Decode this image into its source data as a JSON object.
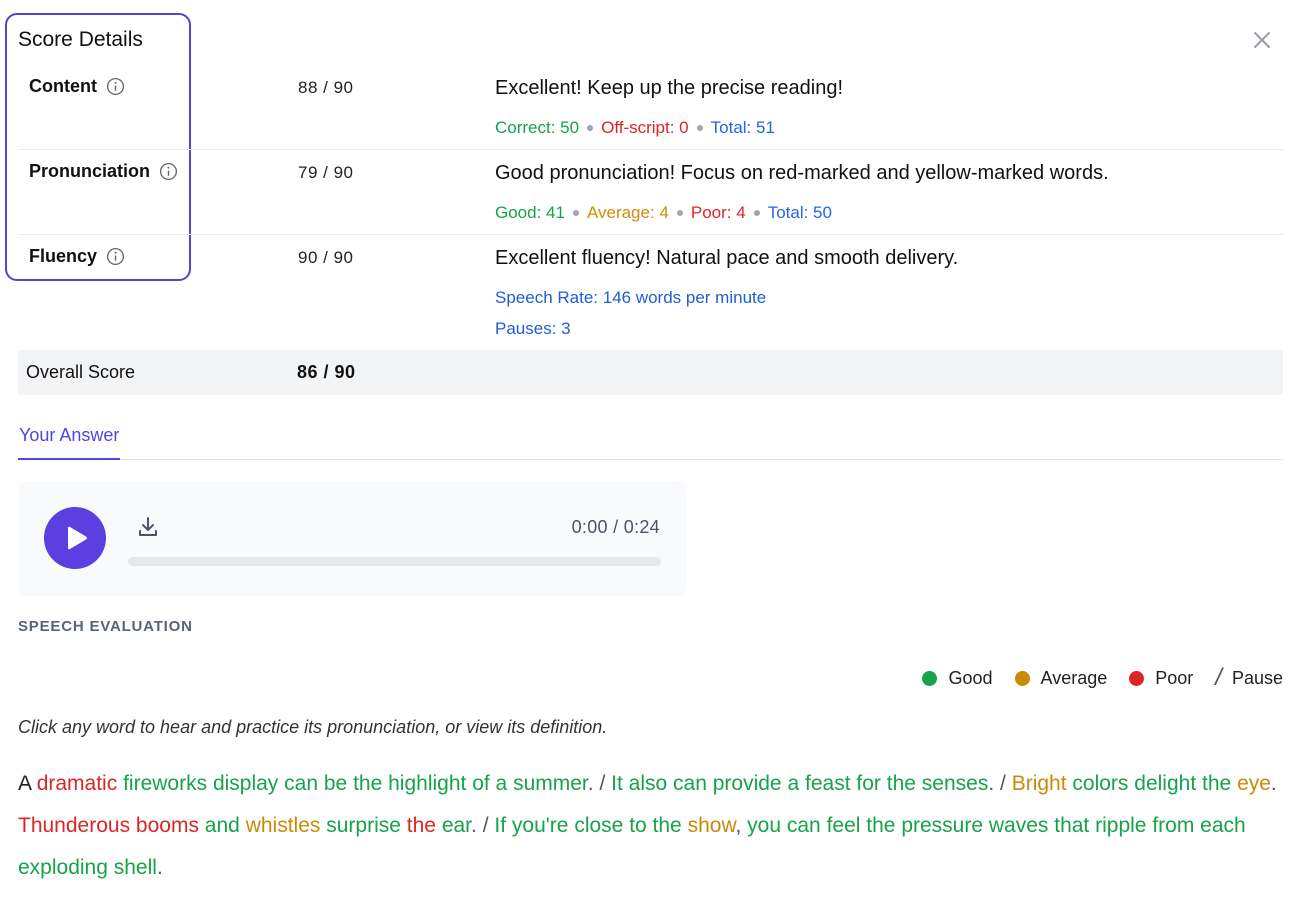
{
  "modal": {
    "title": "Score Details"
  },
  "categories": [
    {
      "name": "Content",
      "score": "88 / 90",
      "feedback": "Excellent! Keep up the precise reading!",
      "stats": [
        {
          "label": "Correct: 50",
          "color": "#16a34a"
        },
        {
          "label": "Off-script: 0",
          "color": "#dc2626"
        },
        {
          "label": "Total: 51",
          "color": "#2563eb"
        }
      ]
    },
    {
      "name": "Pronunciation",
      "score": "79 / 90",
      "feedback": "Good pronunciation! Focus on red-marked and yellow-marked words.",
      "stats": [
        {
          "label": "Good: 41",
          "color": "#16a34a"
        },
        {
          "label": "Average: 4",
          "color": "#d18b06"
        },
        {
          "label": "Poor: 4",
          "color": "#dc2626"
        },
        {
          "label": "Total: 50",
          "color": "#2563eb"
        }
      ]
    },
    {
      "name": "Fluency",
      "score": "90 / 90",
      "feedback": "Excellent fluency! Natural pace and smooth delivery.",
      "speech_rate": "Speech Rate: 146 words per minute",
      "pauses": "Pauses: 3"
    }
  ],
  "overall": {
    "label": "Overall Score",
    "score": "86 / 90"
  },
  "tabs": {
    "your_answer": "Your Answer"
  },
  "player": {
    "time": "0:00 / 0:24",
    "progress": 0
  },
  "evaluation": {
    "section_title": "SPEECH EVALUATION",
    "legend": {
      "good": "Good",
      "average": "Average",
      "poor": "Poor",
      "pause": "Pause"
    },
    "hint": "Click any word to hear and practice its pronunciation, or view its definition.",
    "colors": {
      "good": "#16a34a",
      "average": "#ca8a04",
      "poor": "#dc2626"
    },
    "words": [
      [
        "A",
        "plain"
      ],
      [
        "dramatic",
        "poor"
      ],
      [
        "fireworks",
        "good"
      ],
      [
        "display",
        "good"
      ],
      [
        "can",
        "good"
      ],
      [
        "be",
        "good"
      ],
      [
        "the",
        "good"
      ],
      [
        "highlight",
        "good"
      ],
      [
        "of",
        "good"
      ],
      [
        "a",
        "good"
      ],
      [
        "summer",
        "good"
      ],
      [
        ".",
        "punct"
      ],
      [
        "/",
        "pause"
      ],
      [
        "It",
        "good"
      ],
      [
        "also",
        "good"
      ],
      [
        "can",
        "good"
      ],
      [
        "provide",
        "good"
      ],
      [
        "a",
        "good"
      ],
      [
        "feast",
        "good"
      ],
      [
        "for",
        "good"
      ],
      [
        "the",
        "good"
      ],
      [
        "senses",
        "good"
      ],
      [
        ".",
        "punct"
      ],
      [
        "/",
        "pause"
      ],
      [
        "Bright",
        "avg"
      ],
      [
        "colors",
        "good"
      ],
      [
        "delight",
        "good"
      ],
      [
        "the",
        "good"
      ],
      [
        "eye",
        "avg"
      ],
      [
        ".",
        "punct"
      ],
      [
        "Thunderous",
        "poor"
      ],
      [
        "booms",
        "poor"
      ],
      [
        "and",
        "good"
      ],
      [
        "whistles",
        "avg"
      ],
      [
        "surprise",
        "good"
      ],
      [
        "the",
        "poor"
      ],
      [
        "ear",
        "good"
      ],
      [
        ".",
        "punct"
      ],
      [
        "/",
        "pause"
      ],
      [
        "If",
        "good"
      ],
      [
        "you're",
        "good"
      ],
      [
        "close",
        "good"
      ],
      [
        "to",
        "good"
      ],
      [
        "the",
        "good"
      ],
      [
        "show",
        "avg"
      ],
      [
        ",",
        "punct"
      ],
      [
        "you",
        "good"
      ],
      [
        "can",
        "good"
      ],
      [
        "feel",
        "good"
      ],
      [
        "the",
        "good"
      ],
      [
        "pressure",
        "good"
      ],
      [
        "waves",
        "good"
      ],
      [
        "that",
        "good"
      ],
      [
        "ripple",
        "good"
      ],
      [
        "from",
        "good"
      ],
      [
        "each",
        "good"
      ],
      [
        "exploding",
        "good"
      ],
      [
        "shell",
        "good"
      ],
      [
        ".",
        "punct"
      ]
    ]
  }
}
